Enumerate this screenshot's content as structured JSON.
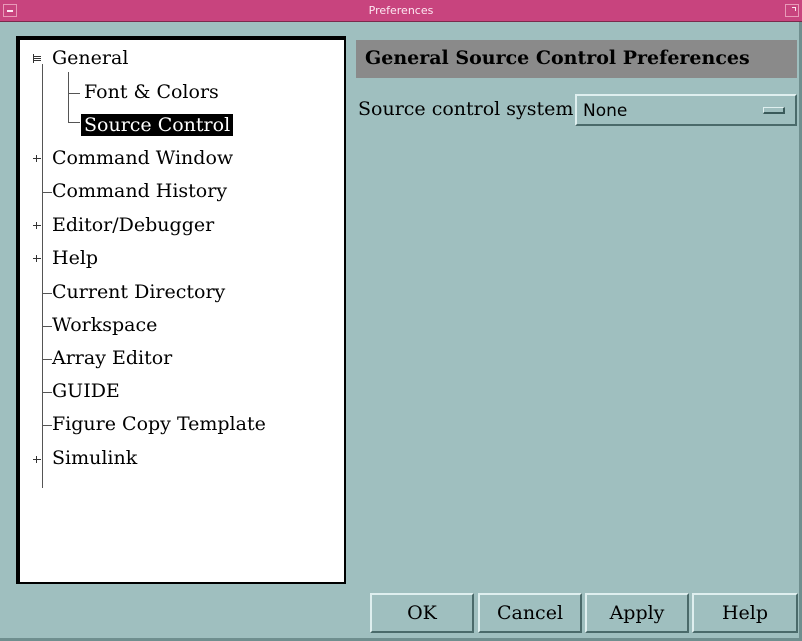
{
  "window": {
    "title": "Preferences"
  },
  "tree": {
    "items": [
      {
        "label": "General",
        "expander": "minus"
      },
      {
        "label": "Font & Colors",
        "expander": "none"
      },
      {
        "label": "Source Control",
        "expander": "none",
        "selected": true
      },
      {
        "label": "Command Window",
        "expander": "plus"
      },
      {
        "label": "Command History",
        "expander": "none"
      },
      {
        "label": "Editor/Debugger",
        "expander": "plus"
      },
      {
        "label": "Help",
        "expander": "plus"
      },
      {
        "label": "Current Directory",
        "expander": "none"
      },
      {
        "label": "Workspace",
        "expander": "none"
      },
      {
        "label": "Array Editor",
        "expander": "none"
      },
      {
        "label": "GUIDE",
        "expander": "none"
      },
      {
        "label": "Figure Copy Template",
        "expander": "none"
      },
      {
        "label": "Simulink",
        "expander": "plus"
      }
    ]
  },
  "main": {
    "header": "General Source Control Preferences",
    "source_control_label": "Source control system:",
    "source_control_value": "None"
  },
  "buttons": {
    "ok": "OK",
    "cancel": "Cancel",
    "apply": "Apply",
    "help": "Help"
  },
  "colors": {
    "titlebar": "#c8447e",
    "dialog_bg": "#9fbfbf",
    "header_bg": "#8a8a8a"
  }
}
